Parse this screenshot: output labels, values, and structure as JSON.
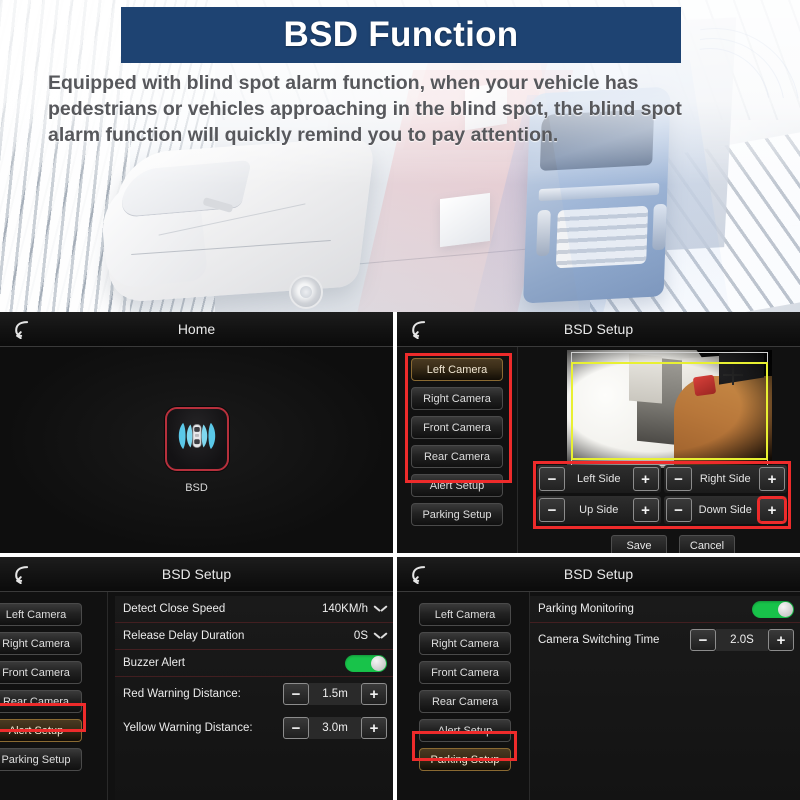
{
  "hero": {
    "title": "BSD Function",
    "description": "Equipped with blind spot alarm function, when your vehicle has pedestrians or vehicles approaching in the blind spot, the blind spot alarm function will quickly remind you to pay attention.",
    "banner_color": "#1e4372",
    "text_color": "#57585c"
  },
  "panels": {
    "home": {
      "header_title": "Home",
      "back_icon": "back-arrow-icon",
      "app_icon": "bsd-radar-icon",
      "app_label": "BSD",
      "highlight_color": "#b6303c"
    },
    "camera_setup": {
      "header_title": "BSD Setup",
      "back_icon": "back-arrow-icon",
      "menu": [
        {
          "label": "Left Camera",
          "selected": true
        },
        {
          "label": "Right Camera",
          "selected": false
        },
        {
          "label": "Front Camera",
          "selected": false
        },
        {
          "label": "Rear Camera",
          "selected": false
        },
        {
          "label": "Alert Setup",
          "selected": false
        },
        {
          "label": "Parking Setup",
          "selected": false
        }
      ],
      "adjust": [
        {
          "minus": "−",
          "label": "Left Side",
          "plus": "+",
          "plus_highlight": false
        },
        {
          "minus": "−",
          "label": "Right Side",
          "plus": "+",
          "plus_highlight": false
        },
        {
          "minus": "−",
          "label": "Up Side",
          "plus": "+",
          "plus_highlight": false
        },
        {
          "minus": "−",
          "label": "Down Side",
          "plus": "+",
          "plus_highlight": true
        }
      ],
      "save_label": "Save",
      "cancel_label": "Cancel",
      "guide_box_color": "#e8f032",
      "annotation_color": "#ee2b2b"
    },
    "alert_setup": {
      "header_title": "BSD Setup",
      "back_icon": "back-arrow-icon",
      "menu": [
        {
          "label": "Left Camera",
          "selected": false
        },
        {
          "label": "Right Camera",
          "selected": false
        },
        {
          "label": "Front Camera",
          "selected": false
        },
        {
          "label": "Rear Camera",
          "selected": false
        },
        {
          "label": "Alert Setup",
          "selected": true
        },
        {
          "label": "Parking Setup",
          "selected": false
        }
      ],
      "rows": {
        "detect_close_speed": {
          "label": "Detect Close Speed",
          "value": "140KM/h",
          "control": "dropdown"
        },
        "release_delay": {
          "label": "Release Delay Duration",
          "value": "0S",
          "control": "dropdown"
        },
        "buzzer_alert": {
          "label": "Buzzer Alert",
          "value": "on",
          "control": "toggle"
        },
        "red_warning": {
          "label": "Red Warning Distance:",
          "value": "1.5m",
          "minus": "−",
          "plus": "+",
          "control": "stepper"
        },
        "yellow_warning": {
          "label": "Yellow Warning Distance:",
          "value": "3.0m",
          "minus": "−",
          "plus": "+",
          "control": "stepper"
        }
      },
      "toggle_on_color": "#18c34a"
    },
    "parking_setup": {
      "header_title": "BSD Setup",
      "back_icon": "back-arrow-icon",
      "menu": [
        {
          "label": "Left Camera",
          "selected": false
        },
        {
          "label": "Right Camera",
          "selected": false
        },
        {
          "label": "Front Camera",
          "selected": false
        },
        {
          "label": "Rear Camera",
          "selected": false
        },
        {
          "label": "Alert Setup",
          "selected": false
        },
        {
          "label": "Parking Setup",
          "selected": true
        }
      ],
      "rows": {
        "parking_monitoring": {
          "label": "Parking Monitoring",
          "value": "on",
          "control": "toggle"
        },
        "camera_switching_time": {
          "label": "Camera Switching Time",
          "value": "2.0S",
          "minus": "−",
          "plus": "+",
          "control": "stepper"
        }
      },
      "toggle_on_color": "#18c34a"
    }
  }
}
